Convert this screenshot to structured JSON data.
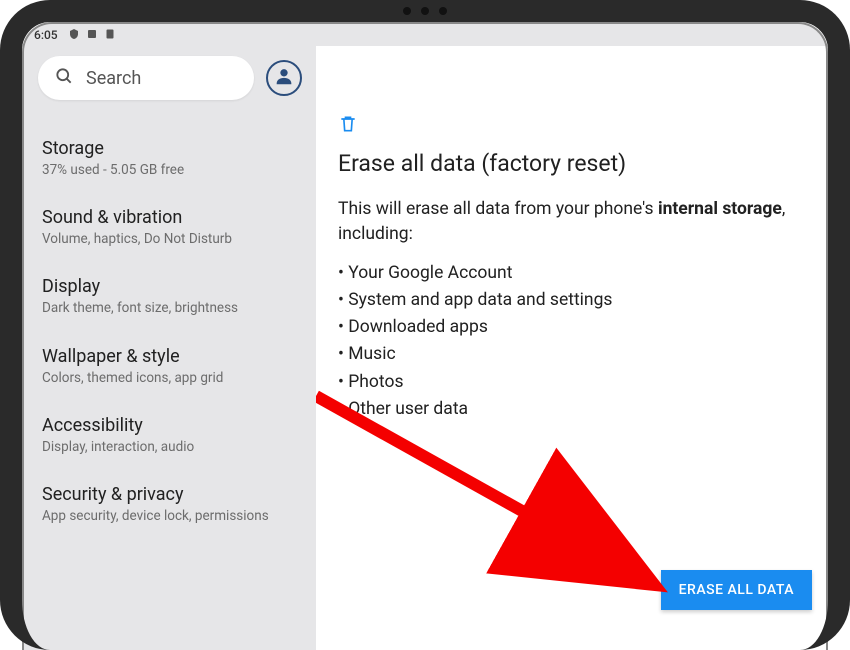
{
  "status_bar": {
    "time": "6:05"
  },
  "search": {
    "placeholder": "Search"
  },
  "sidebar": {
    "items": [
      {
        "title": "Storage",
        "subtitle": "37% used - 5.05 GB free"
      },
      {
        "title": "Sound & vibration",
        "subtitle": "Volume, haptics, Do Not Disturb"
      },
      {
        "title": "Display",
        "subtitle": "Dark theme, font size, brightness"
      },
      {
        "title": "Wallpaper & style",
        "subtitle": "Colors, themed icons, app grid"
      },
      {
        "title": "Accessibility",
        "subtitle": "Display, interaction, audio"
      },
      {
        "title": "Security & privacy",
        "subtitle": "App security, device lock, permissions"
      }
    ]
  },
  "main": {
    "title": "Erase all data (factory reset)",
    "lead_prefix": "This will erase all data from your phone's ",
    "lead_bold": "internal storage",
    "lead_suffix": ", including:",
    "bullets": [
      "Your Google Account",
      "System and app data and settings",
      "Downloaded apps",
      "Music",
      "Photos",
      "Other user data"
    ],
    "erase_button": "ERASE ALL DATA"
  },
  "annotation": {
    "arrow_color": "#f40000"
  }
}
